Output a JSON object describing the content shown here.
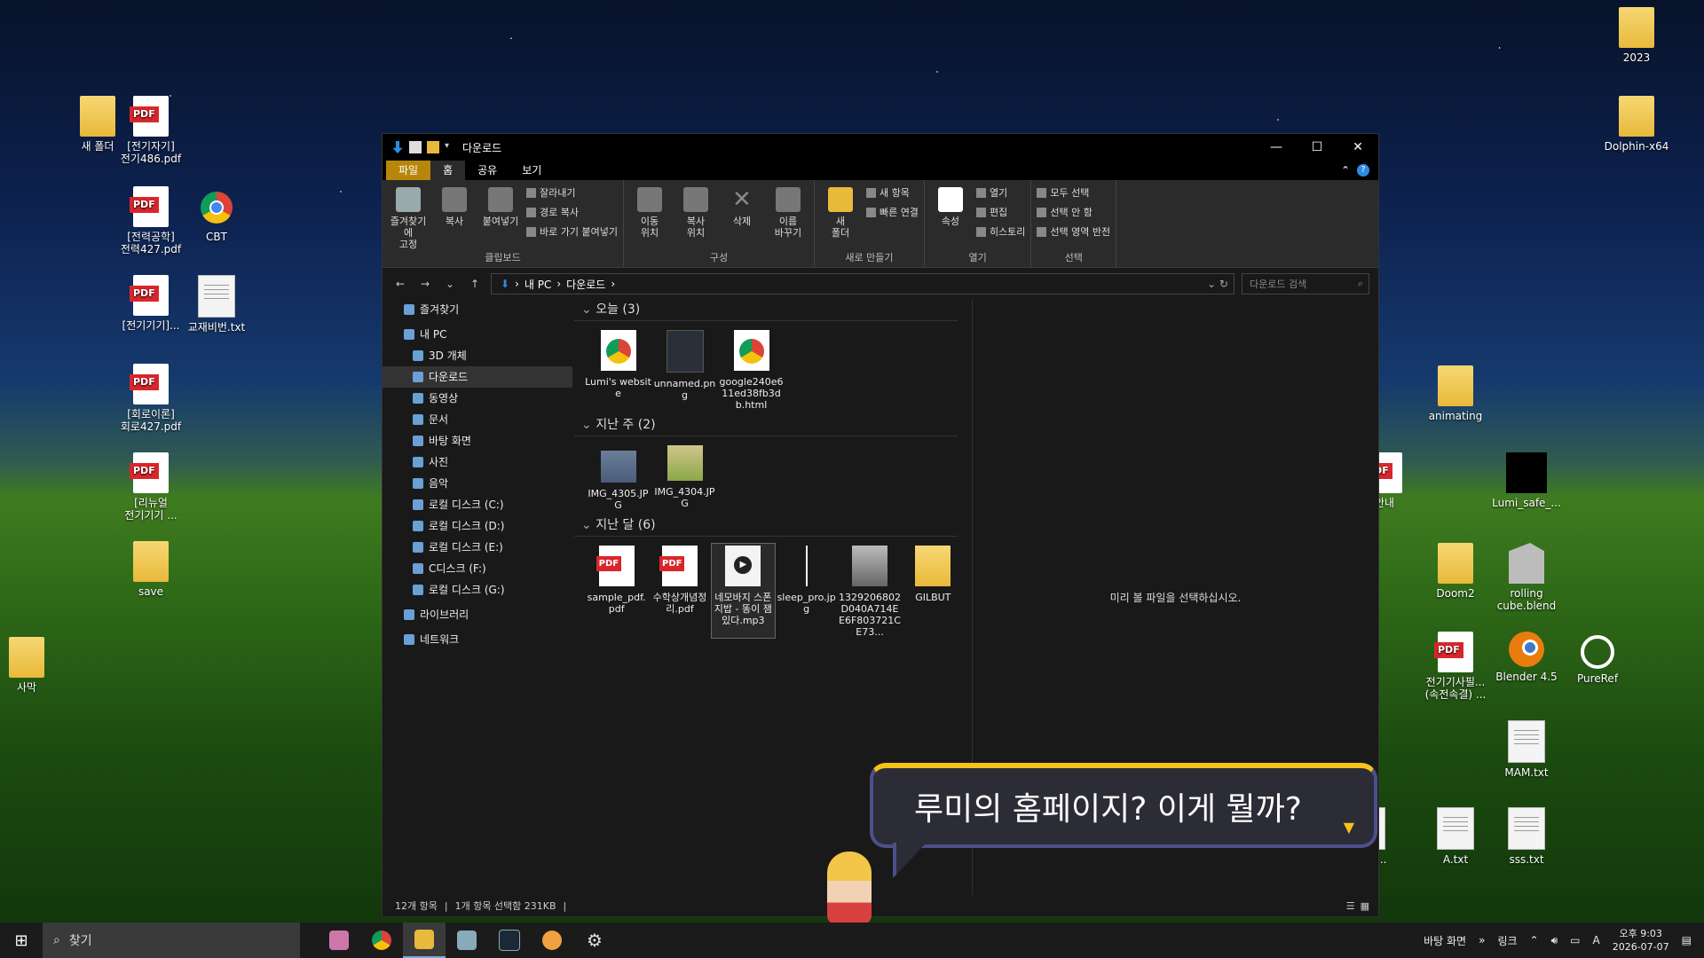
{
  "desktop": {
    "icons": [
      {
        "label": "새 폴더",
        "type": "folder"
      },
      {
        "label": "[전기자기]\n전기486.pdf",
        "type": "pdf"
      },
      {
        "label": "[전력공학]\n전력427.pdf",
        "type": "pdf"
      },
      {
        "label": "CBT",
        "type": "chrome"
      },
      {
        "label": "[전기기기]...",
        "type": "pdf"
      },
      {
        "label": "교재비번.txt",
        "type": "txt"
      },
      {
        "label": "[회로이론]\n회로427.pdf",
        "type": "pdf"
      },
      {
        "label": "[리뉴얼\n전기기기 ...",
        "type": "pdf"
      },
      {
        "label": "save",
        "type": "folder"
      },
      {
        "label": "사막",
        "type": "folder"
      },
      {
        "label": "2023",
        "type": "folder"
      },
      {
        "label": "Dolphin-x64",
        "type": "folder"
      },
      {
        "label": "animating",
        "type": "folder"
      },
      {
        "label": "Lumi_safe_...",
        "type": "black"
      },
      {
        "label": "안내",
        "type": "pdf"
      },
      {
        "label": "Doom2",
        "type": "folder"
      },
      {
        "label": "rolling\ncube.blend",
        "type": "blendfile"
      },
      {
        "label": "전기기사필...\n(속전속결) ...",
        "type": "pdf"
      },
      {
        "label": "Blender 4.5",
        "type": "blender"
      },
      {
        "label": "PureRef",
        "type": "pure"
      },
      {
        "label": "MAM.txt",
        "type": "txt"
      },
      {
        "label": "engin...",
        "type": "txt"
      },
      {
        "label": "A.txt",
        "type": "txt"
      },
      {
        "label": "sss.txt",
        "type": "txt"
      }
    ]
  },
  "window": {
    "title": "다운로드",
    "tabs": [
      "파일",
      "홈",
      "공유",
      "보기"
    ],
    "ribbon": {
      "clipboard": {
        "label": "클립보드",
        "pin": "즐겨찾기에\n고정",
        "copy": "복사",
        "paste": "붙여넣기",
        "cut": "잘라내기",
        "copy_path": "경로 복사",
        "paste_shortcut": "바로 가기 붙여넣기"
      },
      "organize": {
        "label": "구성",
        "move": "이동\n위치",
        "copyto": "복사\n위치",
        "delete": "삭제",
        "rename": "이름\n바꾸기"
      },
      "new": {
        "label": "새로 만들기",
        "new_folder": "새\n폴더",
        "new_item": "새 항목",
        "easy_access": "빠른 연결"
      },
      "open": {
        "label": "열기",
        "properties": "속성",
        "open": "열기",
        "edit": "편집",
        "history": "히스토리"
      },
      "select": {
        "label": "선택",
        "all": "모두 선택",
        "none": "선택 안 함",
        "invert": "선택 영역 반전"
      }
    },
    "address": {
      "path": [
        "내 PC",
        "다운로드"
      ],
      "search_placeholder": "다운로드 검색"
    },
    "nav": [
      {
        "label": "즐겨찾기",
        "level": 1
      },
      {
        "label": "내 PC",
        "level": 1
      },
      {
        "label": "3D 개체",
        "level": 2
      },
      {
        "label": "다운로드",
        "level": 2,
        "selected": true
      },
      {
        "label": "동영상",
        "level": 2
      },
      {
        "label": "문서",
        "level": 2
      },
      {
        "label": "바탕 화면",
        "level": 2
      },
      {
        "label": "사진",
        "level": 2
      },
      {
        "label": "음악",
        "level": 2
      },
      {
        "label": "로컬 디스크 (C:)",
        "level": 2
      },
      {
        "label": "로컬 디스크 (D:)",
        "level": 2
      },
      {
        "label": "로컬 디스크 (E:)",
        "level": 2
      },
      {
        "label": "C디스크 (F:)",
        "level": 2
      },
      {
        "label": "로컬 디스크 (G:)",
        "level": 2
      },
      {
        "label": "라이브러리",
        "level": 1
      },
      {
        "label": "네트워크",
        "level": 1
      }
    ],
    "groups": [
      {
        "title": "오늘 (3)",
        "files": [
          {
            "name": "Lumi's website",
            "thumb": "chrome"
          },
          {
            "name": "unnamed.png",
            "thumb": "dark"
          },
          {
            "name": "google240e611ed38fb3db.html",
            "thumb": "chrome"
          }
        ]
      },
      {
        "title": "지난 주 (2)",
        "files": [
          {
            "name": "IMG_4305.JPG",
            "thumb": "img"
          },
          {
            "name": "IMG_4304.JPG",
            "thumb": "img2"
          }
        ]
      },
      {
        "title": "지난 달 (6)",
        "files": [
          {
            "name": "sample_pdf.pdf",
            "thumb": "pdf"
          },
          {
            "name": "수학상개념정리.pdf",
            "thumb": "pdf"
          },
          {
            "name": "네모바지 스폰지밥 - 똥이 잼있다.mp3",
            "thumb": "mp3",
            "selected": true
          },
          {
            "name": "sleep_pro.jpg",
            "thumb": "line"
          },
          {
            "name": "1329206802D040A714EE6F803721CE73...",
            "thumb": "photo"
          },
          {
            "name": "GILBUT",
            "thumb": "folder"
          }
        ]
      }
    ],
    "preview_text": "미리 볼 파일을 선택하십시오.",
    "status": {
      "count": "12개 항목",
      "selection": "1개 항목 선택함 231KB"
    }
  },
  "overlay": {
    "bubble_text": "루미의 홈페이지? 이게 뭘까?",
    "arrow": "▼"
  },
  "taskbar": {
    "search_label": "찾기",
    "apps": [
      "game-app",
      "chrome",
      "file-explorer",
      "photos",
      "steam",
      "chat-app",
      "settings"
    ],
    "tray": {
      "desktop_label": "바탕 화면",
      "link_label": "링크",
      "ime": "A",
      "time": "오후 9:03",
      "date": "2026-07-07"
    }
  },
  "colors": {
    "accent": "#f6c21a",
    "file_tab": "#b8860b",
    "bubble_border": "#4d4f8a"
  }
}
